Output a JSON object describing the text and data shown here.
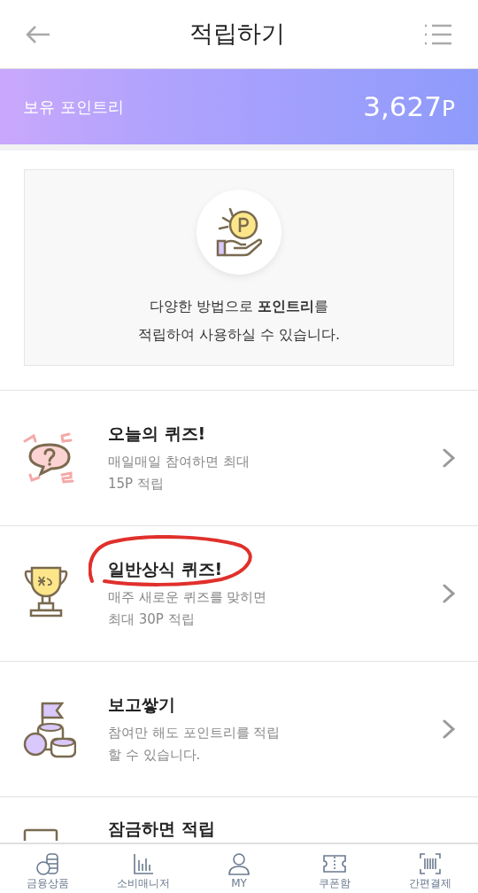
{
  "header": {
    "title": "적립하기"
  },
  "balance": {
    "label": "보유 포인트리",
    "amount": "3,627",
    "unit": "P"
  },
  "intro": {
    "lines": [
      "다양한 방법으로 **포인트리**를",
      "적립하여 사용하실 수 있습니다."
    ]
  },
  "items": [
    {
      "kind": "quiz",
      "title": "오늘의 퀴즈!",
      "description": [
        "매일매일 참여하면 최대",
        "15P 적립"
      ],
      "circled": false
    },
    {
      "kind": "trophy",
      "title": "일반상식 퀴즈!",
      "description": [
        "매주 새로운 퀴즈를 맞히면",
        "최대 30P 적립"
      ],
      "circled": true
    },
    {
      "kind": "coins",
      "title": "보고쌓기",
      "description": [
        "참여만 해도 포인트리를 적립",
        "할 수 있습니다."
      ],
      "circled": false
    },
    {
      "kind": "lock",
      "title": "잠금하면 적립"
    }
  ],
  "bottom_nav": [
    {
      "kind": "products",
      "label": "금융상품"
    },
    {
      "kind": "manager",
      "label": "소비매니저"
    },
    {
      "kind": "my",
      "label": "MY"
    },
    {
      "kind": "coupon",
      "label": "쿠폰함"
    },
    {
      "kind": "pay",
      "label": "간편결제"
    }
  ]
}
